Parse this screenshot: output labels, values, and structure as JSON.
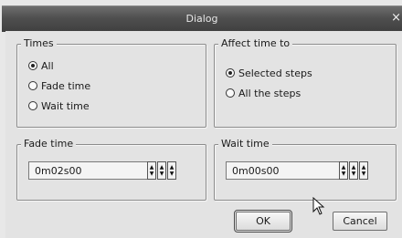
{
  "window": {
    "title": "Dialog",
    "close_glyph": "×"
  },
  "times_group": {
    "legend": "Times",
    "options": [
      {
        "label": "All",
        "checked": true
      },
      {
        "label": "Fade time",
        "checked": false
      },
      {
        "label": "Wait time",
        "checked": false
      }
    ]
  },
  "affect_group": {
    "legend": "Affect time to",
    "options": [
      {
        "label": "Selected steps",
        "checked": true
      },
      {
        "label": "All the steps",
        "checked": false
      }
    ]
  },
  "fade_group": {
    "legend": "Fade time",
    "value": "0m02s00"
  },
  "wait_group": {
    "legend": "Wait time",
    "value": "0m00s00"
  },
  "buttons": {
    "ok": "OK",
    "cancel": "Cancel"
  },
  "icons": {
    "close": "close-icon",
    "cursor": "mouse-pointer-icon",
    "stepper": "stepper-icon"
  }
}
